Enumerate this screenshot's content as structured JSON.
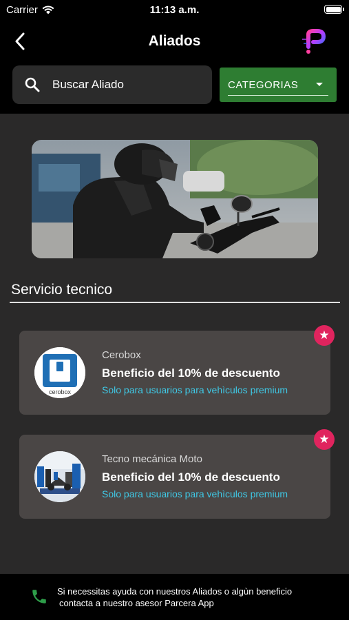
{
  "status_bar": {
    "carrier": "Carrier",
    "time": "11:13 a.m."
  },
  "header": {
    "title": "Aliados",
    "back_icon": "chevron-left-icon",
    "logo": "parcera-logo"
  },
  "search": {
    "placeholder": "Buscar Aliado",
    "value": ""
  },
  "category_select": {
    "label": "CATEGORIAS",
    "color": "#2e7d32"
  },
  "banner": {
    "image": "motorcyclist-helmet-photo"
  },
  "section": {
    "title": "Servicio tecnico"
  },
  "allies": [
    {
      "name": "Cerobox",
      "benefit": "Beneficio del 10% de descuento",
      "note": "Solo para usuarios para vehìculos premium",
      "logo": "cerobox-logo",
      "logo_text": "cerobox",
      "premium_icon": "star-icon"
    },
    {
      "name": "Tecno mecánica Moto",
      "benefit": "Beneficio del 10% de descuento",
      "note": "Solo para usuarios para vehìculos premium",
      "logo": "workshop-photo",
      "premium_icon": "star-icon"
    }
  ],
  "footer": {
    "line1": "Si necessitas ayuda con nuestros Aliados o algùn beneficio",
    "line2": "contacta a nuestro asesor Parcera App",
    "icon": "phone-icon",
    "icon_color": "#2e9e4a"
  },
  "colors": {
    "accent_green": "#2e7d32",
    "premium_badge": "#e0245e",
    "note_text": "#3fc9e6"
  }
}
